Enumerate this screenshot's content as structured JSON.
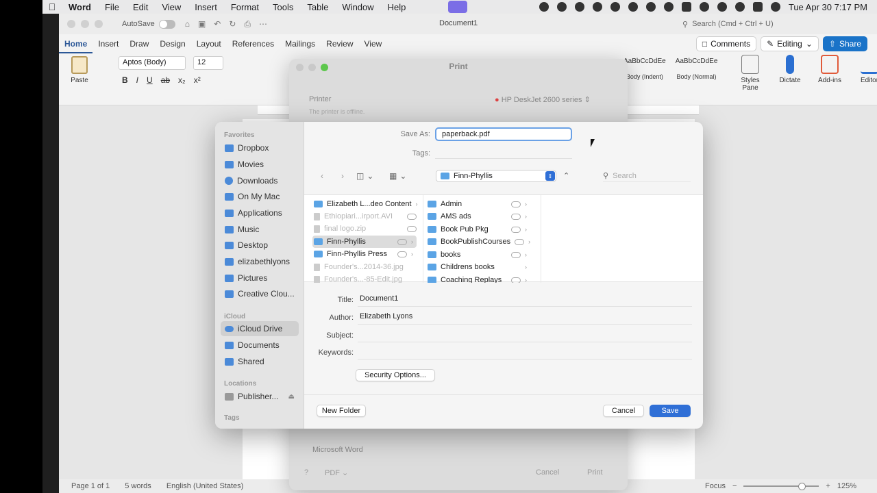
{
  "menubar": {
    "app": "Word",
    "items": [
      "File",
      "Edit",
      "View",
      "Insert",
      "Format",
      "Tools",
      "Table",
      "Window",
      "Help"
    ],
    "datetime": "Tue Apr 30  7:17 PM"
  },
  "word": {
    "autosave_label": "AutoSave",
    "document_title": "Document1",
    "search_placeholder": "Search (Cmd + Ctrl + U)",
    "tabs": [
      "Home",
      "Insert",
      "Draw",
      "Design",
      "Layout",
      "References",
      "Mailings",
      "Review",
      "View"
    ],
    "comments_label": "Comments",
    "editing_label": "Editing",
    "share_label": "Share",
    "paste_label": "Paste",
    "font_name": "Aptos (Body)",
    "font_size": "12",
    "styles": [
      {
        "sample": "AaBbCcDdEe",
        "name": "Body (Indent)"
      },
      {
        "sample": "AaBbCcDdEe",
        "name": "Body (Normal)"
      }
    ],
    "tools": [
      "Styles Pane",
      "Dictate",
      "Add-ins",
      "Editor"
    ],
    "status": {
      "page": "Page 1 of 1",
      "words": "5 words",
      "language": "English (United States)",
      "focus": "Focus",
      "zoom": "125%"
    }
  },
  "print_dialog": {
    "title": "Print",
    "printer_label": "Printer",
    "printer_name": "HP DeskJet 2600 series",
    "offline_note": "The printer is offline.",
    "app_label": "Microsoft Word",
    "pdf_label": "PDF",
    "cancel_label": "Cancel",
    "print_label": "Print"
  },
  "save_dialog": {
    "save_as_label": "Save As:",
    "save_as_value": "paperback.pdf",
    "tags_label": "Tags:",
    "location": "Finn-Phyllis",
    "search_placeholder": "Search",
    "sidebar": {
      "favorites_header": "Favorites",
      "favorites": [
        "Dropbox",
        "Movies",
        "Downloads",
        "On My Mac",
        "Applications",
        "Music",
        "Desktop",
        "elizabethlyons",
        "Pictures",
        "Creative Clou..."
      ],
      "icloud_header": "iCloud",
      "icloud": [
        "iCloud Drive",
        "Documents",
        "Shared"
      ],
      "locations_header": "Locations",
      "locations": [
        "Publisher..."
      ],
      "tags_header": "Tags"
    },
    "column1": [
      {
        "name": "Elizabeth L...deo Content",
        "kind": "folder",
        "dim": false,
        "sel": false
      },
      {
        "name": "Ethiopiari...irport.AVI",
        "kind": "file",
        "dim": true,
        "sel": false
      },
      {
        "name": "final logo.zip",
        "kind": "file",
        "dim": true,
        "sel": false
      },
      {
        "name": "Finn-Phyllis",
        "kind": "folder",
        "dim": false,
        "sel": true
      },
      {
        "name": "Finn-Phyllis Press",
        "kind": "folder",
        "dim": false,
        "sel": false
      },
      {
        "name": "Founder's...2014-36.jpg",
        "kind": "file",
        "dim": true,
        "sel": false
      },
      {
        "name": "Founder's...-85-Edit.jpg",
        "kind": "file",
        "dim": true,
        "sel": false
      }
    ],
    "column2": [
      "Admin",
      "AMS ads",
      "Book Pub Pkg",
      "BookPublishCourses",
      "books",
      "Childrens books",
      "Coaching Replays"
    ],
    "title_label": "Title:",
    "title_value": "Document1",
    "author_label": "Author:",
    "author_value": "Elizabeth Lyons",
    "subject_label": "Subject:",
    "subject_value": "",
    "keywords_label": "Keywords:",
    "keywords_value": "",
    "security_label": "Security Options...",
    "new_folder_label": "New Folder",
    "cancel_label": "Cancel",
    "save_label": "Save"
  }
}
